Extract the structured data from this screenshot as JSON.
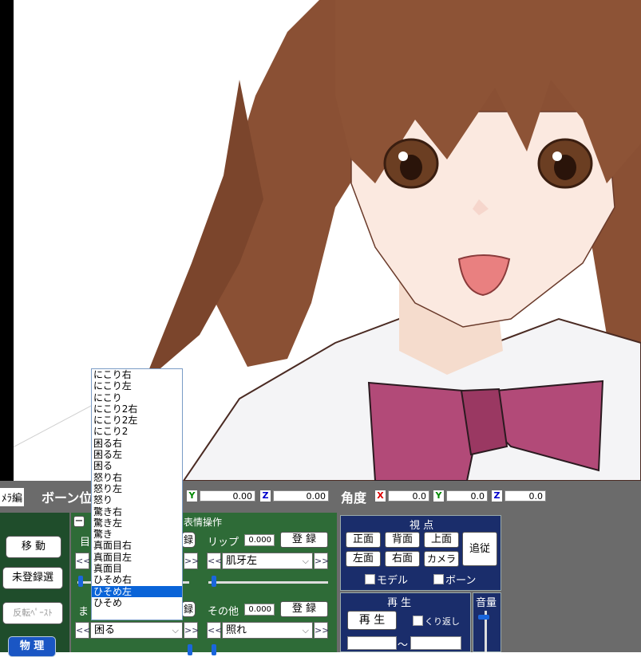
{
  "toolbar": {
    "camera_tab_partial": "ﾒﾗ編",
    "bone_title": "ボーン位",
    "pos_y": "Y",
    "pos_y_val": "0.00",
    "pos_z": "Z",
    "pos_z_val": "0.00",
    "angle_label": "角度",
    "ang_x": "X",
    "ang_x_val": "0.0",
    "ang_y": "Y",
    "ang_y_val": "0.0",
    "ang_z": "Z",
    "ang_z_val": "0.0"
  },
  "left_buttons": {
    "move": "移 動",
    "unregistered": "未登録選",
    "flip_paste": "反転ﾍﾟｰｽﾄ",
    "physics": "物 理"
  },
  "face_panel": {
    "collapse_icon": "−",
    "title": "表情操作",
    "eye_label": "目",
    "register_1": "録",
    "lip_label": "リップ",
    "lip_val": "0.000",
    "lip_register": "登 録",
    "lip_select": "肌牙左",
    "mayu_label": "ま",
    "register_2": "録",
    "other_label": "その他",
    "other_val": "0.000",
    "other_register": "登 録",
    "mayu_select": "困る",
    "other_select": "照れ",
    "prev": "<<",
    "next": ">>"
  },
  "view_panel": {
    "title": "視 点",
    "front": "正面",
    "back": "背面",
    "top": "上面",
    "follow": "追従",
    "left": "左面",
    "right": "右面",
    "camera": "カメラ",
    "model_chk": "モデル",
    "bone_chk": "ボーン"
  },
  "play_panel": {
    "title": "再 生",
    "play_btn": "再 生",
    "repeat": "くり返し",
    "range_sep": "〜"
  },
  "vol_panel": {
    "title": "音量"
  },
  "dropdown": {
    "options": [
      "にこり右",
      "にこり左",
      "にこり",
      "にこり2右",
      "にこり2左",
      "にこり2",
      "困る右",
      "困る左",
      "困る",
      "怒り右",
      "怒り左",
      "怒り",
      "驚き右",
      "驚き左",
      "驚き",
      "真面目右",
      "真面目左",
      "真面目",
      "ひそめ右",
      "ひそめ左",
      "ひそめ"
    ],
    "highlighted_index": 19
  },
  "colors": {
    "face_panel": "#2e6b37",
    "view_panel": "#1a2d6b",
    "highlight": "#0a64d8"
  }
}
